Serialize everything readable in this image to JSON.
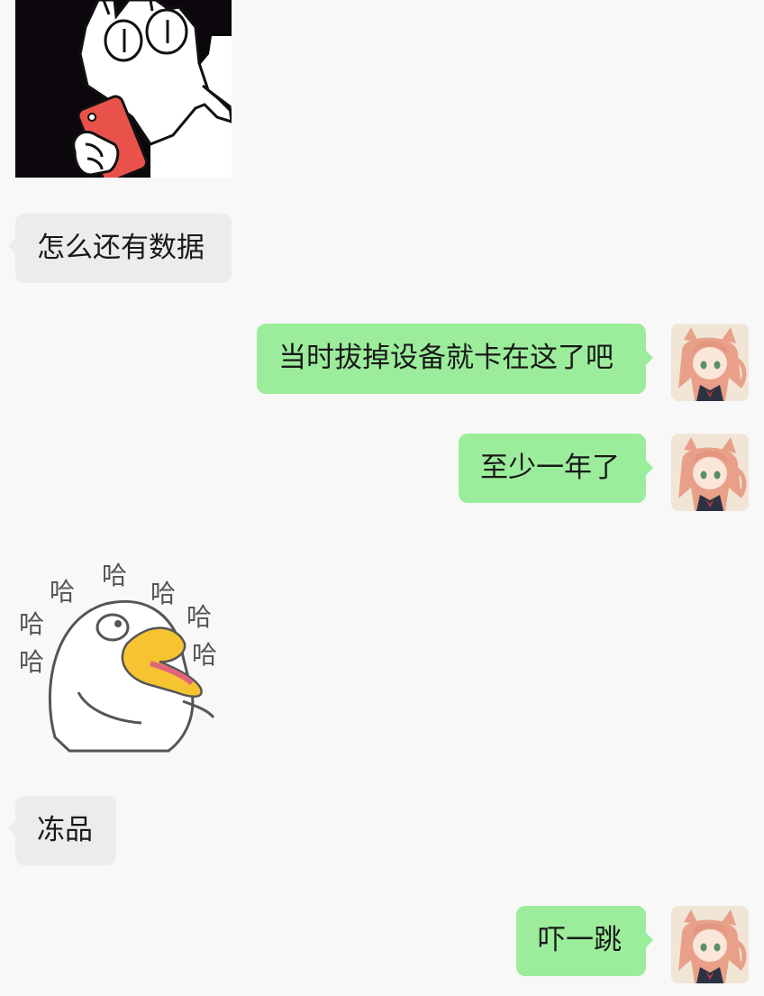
{
  "messages": [
    {
      "side": "in",
      "type": "sticker",
      "icon": "cat-holding-phone-sticker"
    },
    {
      "side": "in",
      "type": "text",
      "text": "怎么还有数据"
    },
    {
      "side": "out",
      "type": "text",
      "text": "当时拔掉设备就卡在这了吧"
    },
    {
      "side": "out",
      "type": "text",
      "text": "至少一年了"
    },
    {
      "side": "in",
      "type": "sticker",
      "icon": "duck-laughing-sticker",
      "caption_chars": "哈"
    },
    {
      "side": "in",
      "type": "text",
      "text": "冻品"
    },
    {
      "side": "out",
      "type": "text",
      "text": "吓一跳"
    }
  ],
  "colors": {
    "background": "#f8f8f8",
    "incoming_bubble": "#ececee",
    "outgoing_bubble": "#9ced9b",
    "text": "#191919"
  }
}
